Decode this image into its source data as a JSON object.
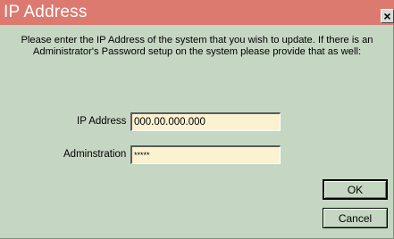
{
  "window": {
    "title": "IP Address",
    "close_symbol": "×"
  },
  "message": "Please enter the IP Address of the system that you wish to update.  If there is an Administrator's Password setup on the system please provide that as well:",
  "form": {
    "ip_label": "IP Address",
    "ip_value": "000.00.000.000",
    "admin_label": "Adminstration",
    "admin_value": "*****"
  },
  "buttons": {
    "ok": "OK",
    "cancel": "Cancel"
  },
  "colors": {
    "title_bar": "#dc7a6f",
    "dialog_bg": "#c5d7c2",
    "field_bg": "#fbf2d1"
  }
}
